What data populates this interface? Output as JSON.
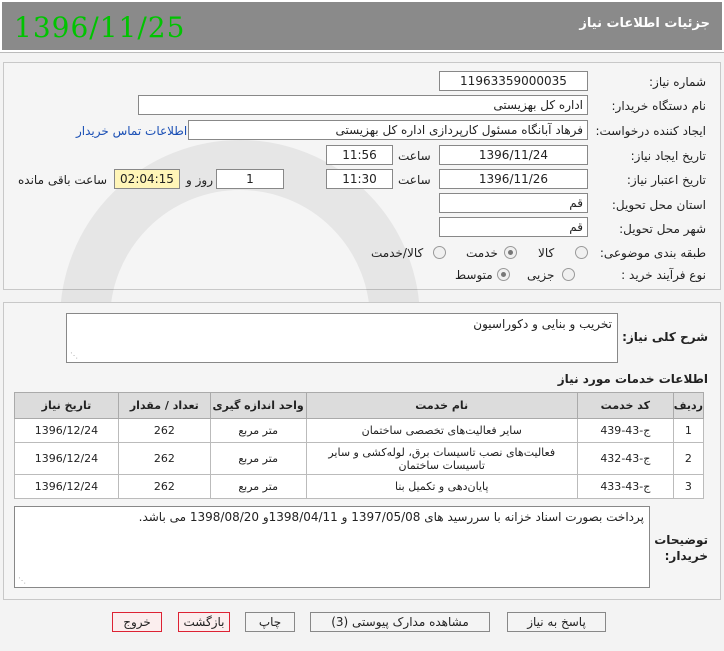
{
  "header": {
    "date": "1396/11/25",
    "title": "جزئیات اطلاعات نیاز"
  },
  "form": {
    "need_number_label": "شماره نیاز:",
    "need_number": "11963359000035",
    "buyer_org_label": "نام دستگاه خریدار:",
    "buyer_org": "اداره کل بهزیستی",
    "creator_label": "ایجاد کننده درخواست:",
    "creator": "فرهاد آبانگاه مسئول کارپردازی اداره کل بهزیستی",
    "contact_link": "اطلاعات تماس خریدار",
    "create_date_label": "تاریخ ایجاد نیاز:",
    "create_date": "1396/11/24",
    "time_label": "ساعت",
    "create_time": "11:56",
    "validity_label": "تاریخ اعتبار نیاز:",
    "validity_date": "1396/11/26",
    "validity_time": "11:30",
    "days": "1",
    "days_label": "روز و",
    "remaining_time": "02:04:15",
    "remaining_label": "ساعت باقی مانده",
    "province_label": "استان محل تحویل:",
    "province": "قم",
    "city_label": "شهر محل تحویل:",
    "city": "قم",
    "category_label": "طبقه بندی موضوعی:",
    "category_options": [
      "کالا",
      "خدمت",
      "کالا/خدمت"
    ],
    "category_selected": "خدمت",
    "process_label": "نوع فرآیند خرید :",
    "process_options": [
      "جزیی",
      "متوسط"
    ],
    "process_selected": "متوسط"
  },
  "summary": {
    "label": "شرح کلی نیاز:",
    "text": "تخریب و بنایی و دکوراسیون"
  },
  "services": {
    "section_title": "اطلاعات خدمات مورد نیاز",
    "columns": [
      "ردیف",
      "کد خدمت",
      "نام خدمت",
      "واحد اندازه گیری",
      "تعداد / مقدار",
      "تاریخ نیاز"
    ],
    "rows": [
      [
        "1",
        "ج-43-439",
        "سایر فعالیت‌های تخصصی ساختمان",
        "متر مربع",
        "262",
        "1396/12/24"
      ],
      [
        "2",
        "ج-43-432",
        "فعالیت‌های نصب تاسیسات برق، لوله‌کشی و سایر تاسیسات ساختمان",
        "متر مربع",
        "262",
        "1396/12/24"
      ],
      [
        "3",
        "ج-43-433",
        "پایان‌دهی و تکمیل بنا",
        "متر مربع",
        "262",
        "1396/12/24"
      ]
    ]
  },
  "buyer_notes": {
    "label": "توضیحات خریدار:",
    "text": "پرداخت بصورت اسناد خزانه با سررسید های 1397/05/08 و 1398/04/11و 1398/08/20 می باشد."
  },
  "buttons": {
    "reply": "پاسخ به نیاز",
    "attachments": "مشاهده مدارک پیوستی (3)",
    "print": "چاپ",
    "back": "بازگشت",
    "exit": "خروج"
  }
}
